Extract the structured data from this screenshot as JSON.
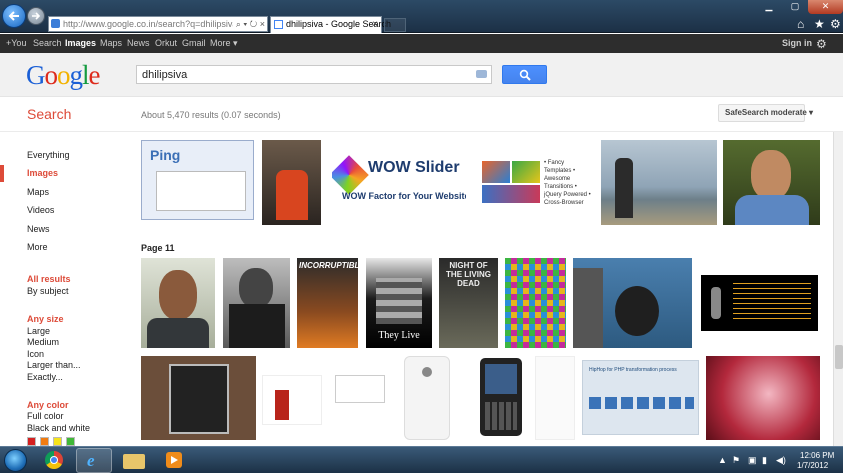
{
  "browser": {
    "address": "http://www.google.co.in/search?q=dhilipsiva&hl=",
    "tab_title": "dhilipsiva - Google Search",
    "tab_close": "×",
    "address_tools": "⌕ ▾ ↻ ×"
  },
  "gbar": {
    "items": [
      "+You",
      "Search",
      "Images",
      "Maps",
      "News",
      "Orkut",
      "Gmail",
      "More ▾"
    ],
    "active": "Images",
    "signin": "Sign in"
  },
  "logo": {
    "letters": [
      "G",
      "o",
      "o",
      "g",
      "l",
      "e"
    ],
    "colors": [
      "#1a5fd6",
      "#dd2a1b",
      "#f2b200",
      "#1a5fd6",
      "#149b3f",
      "#dd2a1b"
    ]
  },
  "search": {
    "query": "dhilipsiva"
  },
  "results": {
    "title": "Search",
    "stats": "About 5,470 results (0.07 seconds)",
    "safesearch": "SafeSearch moderate ▾",
    "page_label": "Page 11"
  },
  "sidebar": {
    "items": [
      "Everything",
      "Images",
      "Maps",
      "Videos",
      "News",
      "More"
    ],
    "selected": "Images",
    "all_results": "All results",
    "by_subject": "By subject",
    "size_head": "Any size",
    "sizes": [
      "Large",
      "Medium",
      "Icon",
      "Larger than...",
      "Exactly..."
    ],
    "color_head": "Any color",
    "colors": [
      "Full color",
      "Black and white"
    ],
    "swatches": [
      "#d42020",
      "#f07c12",
      "#f5e31a",
      "#40b838"
    ]
  },
  "thumb_text": {
    "ping": "Ping",
    "wow": "WOW Slider",
    "wow_sub": "WOW Factor for Your Website!",
    "wow_feats": "• Fancy Templates • Awesome Transitions • jQuery Powered • Cross-Browser",
    "incorruptible": "INCORRUPTIBLE",
    "they_live": "They Live",
    "night": "NIGHT OF THE LIVING DEAD",
    "hiphop": "HipHop for PHP transformation process"
  },
  "taskbar": {
    "time": "12:06 PM",
    "date": "1/7/2012"
  }
}
